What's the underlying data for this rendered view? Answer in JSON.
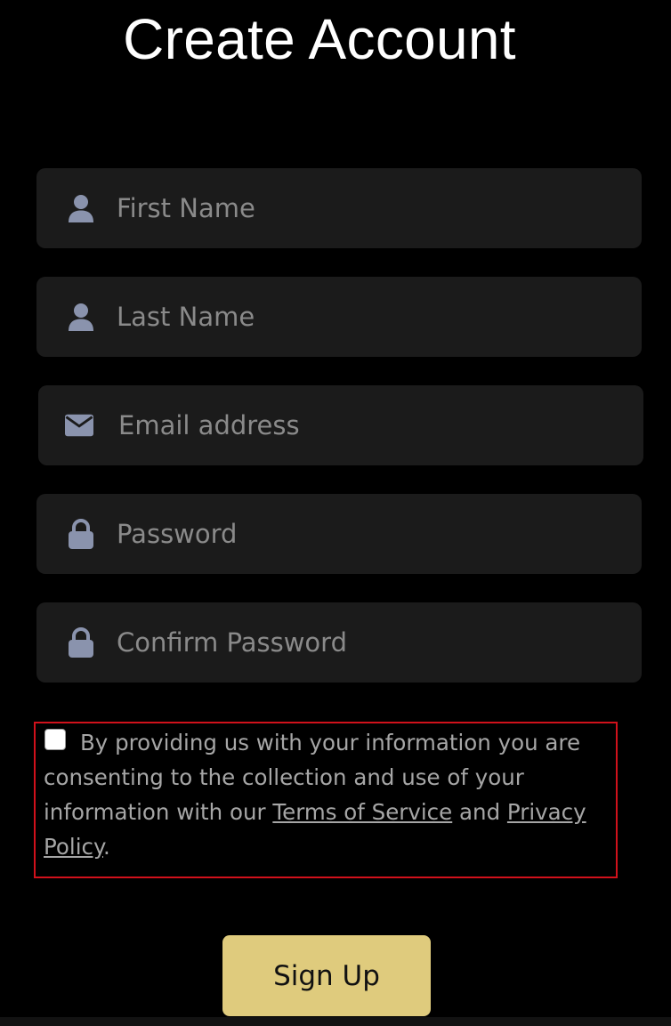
{
  "page": {
    "title": "Create Account"
  },
  "form": {
    "first_name": {
      "placeholder": "First Name",
      "value": "",
      "icon": "user-icon"
    },
    "last_name": {
      "placeholder": "Last Name",
      "value": "",
      "icon": "user-icon"
    },
    "email": {
      "placeholder": "Email address",
      "value": "",
      "icon": "envelope-icon"
    },
    "password": {
      "placeholder": "Password",
      "value": "",
      "icon": "lock-icon"
    },
    "confirm_password": {
      "placeholder": "Confirm Password",
      "value": "",
      "icon": "lock-icon"
    }
  },
  "consent": {
    "checked": false,
    "text_before": "By providing us with your information you are consenting to the collection and use of your information with our ",
    "terms_link": "Terms of Service",
    "conjunction": " and ",
    "privacy_link": "Privacy Policy",
    "text_after": "."
  },
  "actions": {
    "signup_label": "Sign Up"
  },
  "colors": {
    "background": "#000000",
    "field_background": "#1b1b1b",
    "icon": "#8a93ad",
    "accent_button": "#dfcb7d",
    "highlight_border": "#d0111b"
  }
}
